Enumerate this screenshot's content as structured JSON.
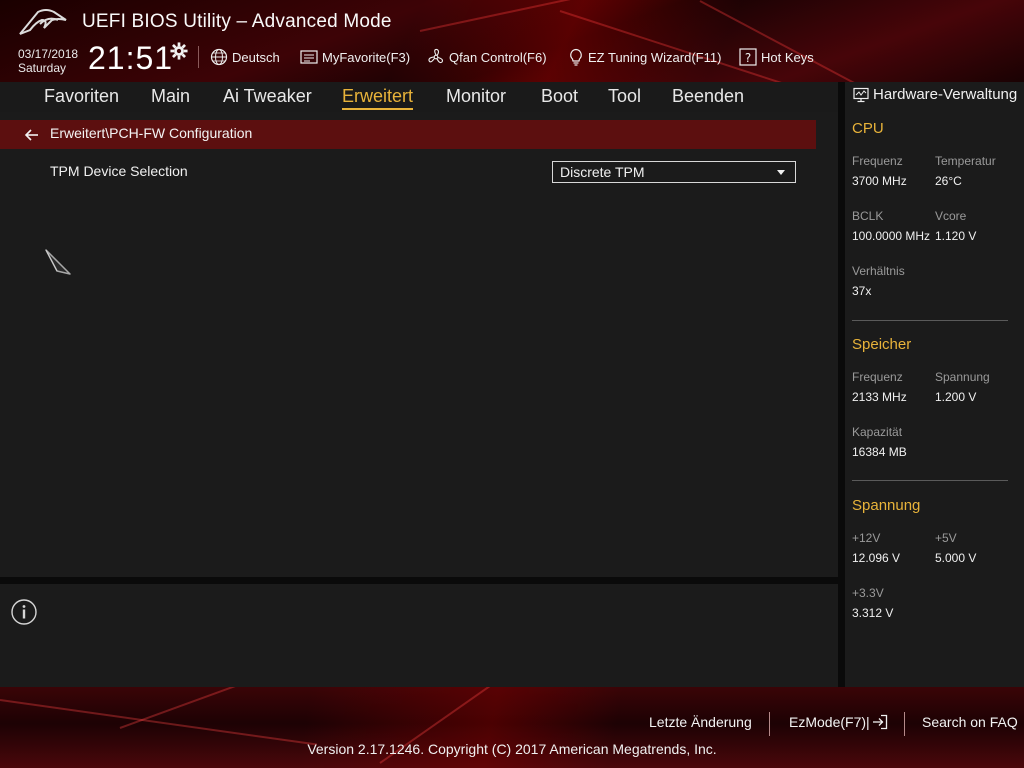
{
  "window": {
    "title": "UEFI BIOS Utility – Advanced Mode",
    "date": "03/17/2018",
    "day": "Saturday",
    "time": "21:51"
  },
  "toolbar": {
    "language": "Deutsch",
    "favorite": "MyFavorite(F3)",
    "qfan": "Qfan Control(F6)",
    "tuning": "EZ Tuning Wizard(F11)",
    "hotkeys": "Hot Keys"
  },
  "nav": {
    "tabs": [
      {
        "label": "Favoriten",
        "active": false
      },
      {
        "label": "Main",
        "active": false
      },
      {
        "label": "Ai Tweaker",
        "active": false
      },
      {
        "label": "Erweitert",
        "active": true
      },
      {
        "label": "Monitor",
        "active": false
      },
      {
        "label": "Boot",
        "active": false
      },
      {
        "label": "Tool",
        "active": false
      },
      {
        "label": "Beenden",
        "active": false
      }
    ]
  },
  "main": {
    "breadcrumb": "Erweitert\\PCH-FW Configuration",
    "settings": [
      {
        "label": "TPM Device Selection",
        "value": "Discrete TPM"
      }
    ]
  },
  "hardware": {
    "title": "Hardware-Verwaltung",
    "cpu": {
      "heading": "CPU",
      "freq_label": "Frequenz",
      "freq_value": "3700 MHz",
      "temp_label": "Temperatur",
      "temp_value": "26°C",
      "bclk_label": "BCLK",
      "bclk_value": "100.0000 MHz",
      "vcore_label": "Vcore",
      "vcore_value": "1.120 V",
      "ratio_label": "Verhältnis",
      "ratio_value": "37x"
    },
    "memory": {
      "heading": "Speicher",
      "freq_label": "Frequenz",
      "freq_value": "2133 MHz",
      "volt_label": "Spannung",
      "volt_value": "1.200 V",
      "cap_label": "Kapazität",
      "cap_value": "16384 MB"
    },
    "voltage": {
      "heading": "Spannung",
      "v12_label": "+12V",
      "v12_value": "12.096 V",
      "v5_label": "+5V",
      "v5_value": "5.000 V",
      "v33_label": "+3.3V",
      "v33_value": "3.312 V"
    }
  },
  "footer": {
    "last_change": "Letzte Änderung",
    "ezmode": "EzMode(F7)|",
    "faq": "Search on FAQ",
    "copyright": "Version 2.17.1246. Copyright (C) 2017 American Megatrends, Inc."
  },
  "colors": {
    "accent": "#e8b33a",
    "breadcrumb_bg": "#5c0f0f",
    "panel_bg": "#1b1b1b"
  }
}
